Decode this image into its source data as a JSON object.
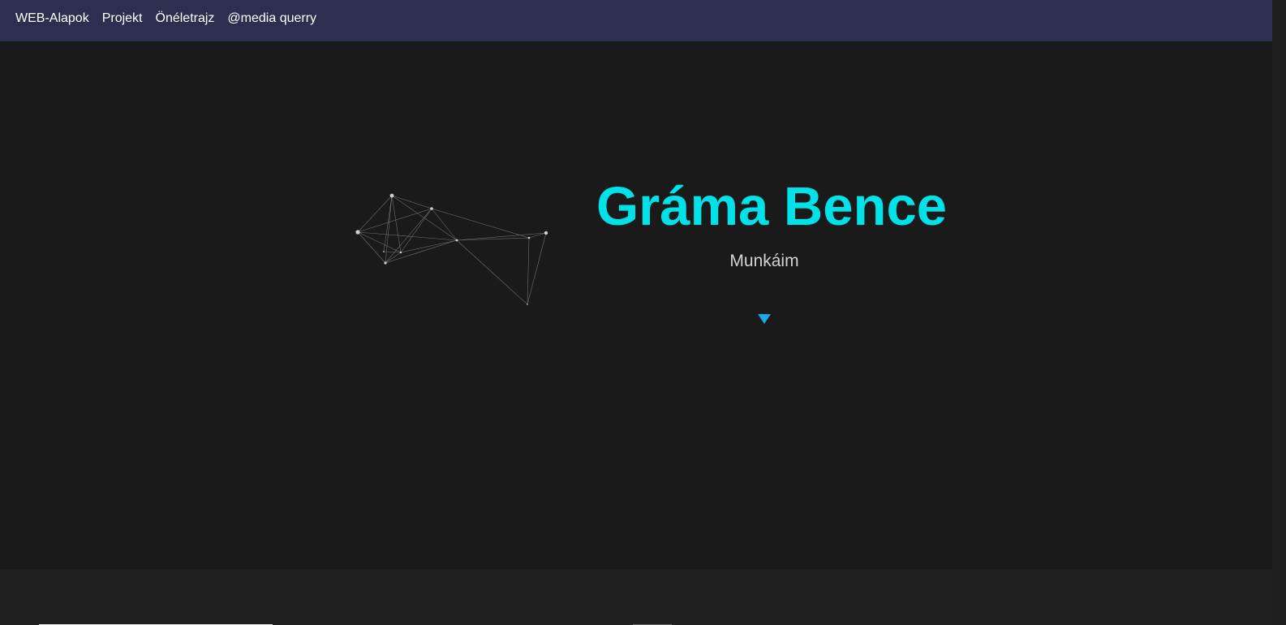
{
  "nav": {
    "items": [
      {
        "label": "WEB-Alapok"
      },
      {
        "label": "Projekt"
      },
      {
        "label": "Önéletrajz"
      },
      {
        "label": "@media querry"
      }
    ]
  },
  "hero": {
    "title": "Gráma Bence",
    "subtitle": "Munkáim",
    "arrow_icon": "triangle-down-icon"
  },
  "colors": {
    "navbar_bg": "#2c2f4f",
    "page_bg": "#1a1a1a",
    "title": "#00e1e8",
    "arrow": "#1aa8e6",
    "subtitle": "#d3d3d3"
  }
}
